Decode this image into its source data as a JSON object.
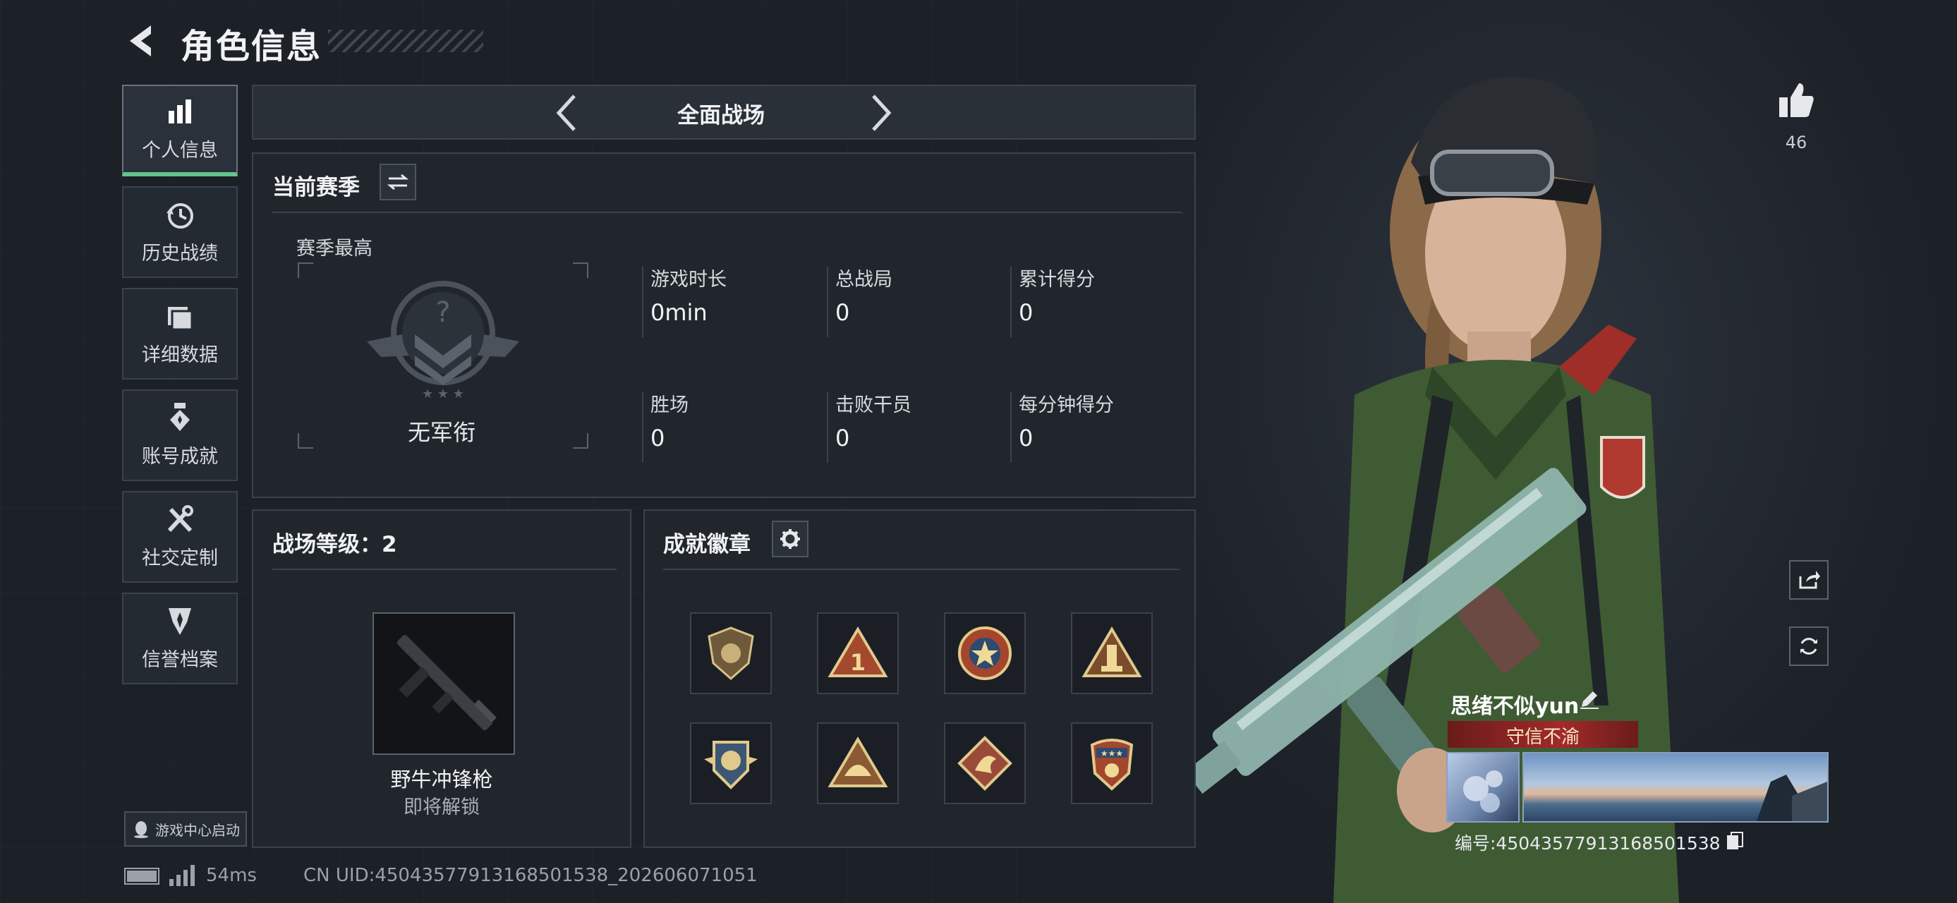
{
  "header": {
    "title": "角色信息"
  },
  "nav": [
    {
      "label": "个人信息",
      "icon": "bar-chart-icon",
      "active": true
    },
    {
      "label": "历史战绩",
      "icon": "history-icon"
    },
    {
      "label": "详细数据",
      "icon": "folder-icon"
    },
    {
      "label": "账号成就",
      "icon": "achievement-icon"
    },
    {
      "label": "社交定制",
      "icon": "tools-icon"
    },
    {
      "label": "信誉档案",
      "icon": "credit-icon"
    }
  ],
  "mode": {
    "title": "全面战场"
  },
  "season": {
    "title": "当前赛季",
    "best_label": "赛季最高",
    "rank": "无军衔",
    "stats": [
      {
        "label": "游戏时长",
        "value": "0min"
      },
      {
        "label": "总战局",
        "value": "0"
      },
      {
        "label": "累计得分",
        "value": "0"
      },
      {
        "label": "胜场",
        "value": "0"
      },
      {
        "label": "击败干员",
        "value": "0"
      },
      {
        "label": "每分钟得分",
        "value": "0"
      }
    ]
  },
  "level": {
    "title": "战场等级：2",
    "weapon_name": "野牛冲锋枪",
    "weapon_status": "即将解锁"
  },
  "badges": {
    "title": "成就徽章",
    "items": [
      "shield-badge",
      "triangle-1-badge",
      "star-medal-badge",
      "tower-badge",
      "wings-badge",
      "helmet-badge",
      "dragon-badge",
      "star-shield-badge"
    ]
  },
  "footer": {
    "launcher": "游戏中心启动",
    "ping": "54ms",
    "uid": "CN UID:4504357791316850153​8_202606071051"
  },
  "profile": {
    "likes": "46",
    "name": "思绪不似yun",
    "title": "守信不渝",
    "id_label": "编号:4504357791316850153​8"
  },
  "colors": {
    "accent": "#62c48c",
    "title_plate": "#a12a2a",
    "bg": "#1c2027"
  }
}
